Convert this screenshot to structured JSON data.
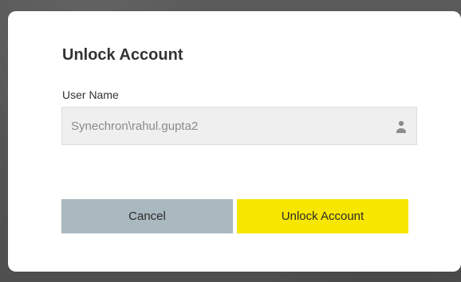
{
  "dialog": {
    "title": "Unlock Account",
    "field_label": "User Name",
    "username_value": "Synechron\\rahul.gupta2",
    "cancel_label": "Cancel",
    "unlock_label": "Unlock Account",
    "icon": "user-icon"
  },
  "colors": {
    "page_bg": "#565656",
    "dialog_bg": "#ffffff",
    "input_bg": "#efefef",
    "input_border": "#dddddd",
    "text_dark": "#333333",
    "text_muted": "#8a8a8a",
    "cancel_bg": "#aab8bf",
    "unlock_bg": "#f7e600"
  }
}
